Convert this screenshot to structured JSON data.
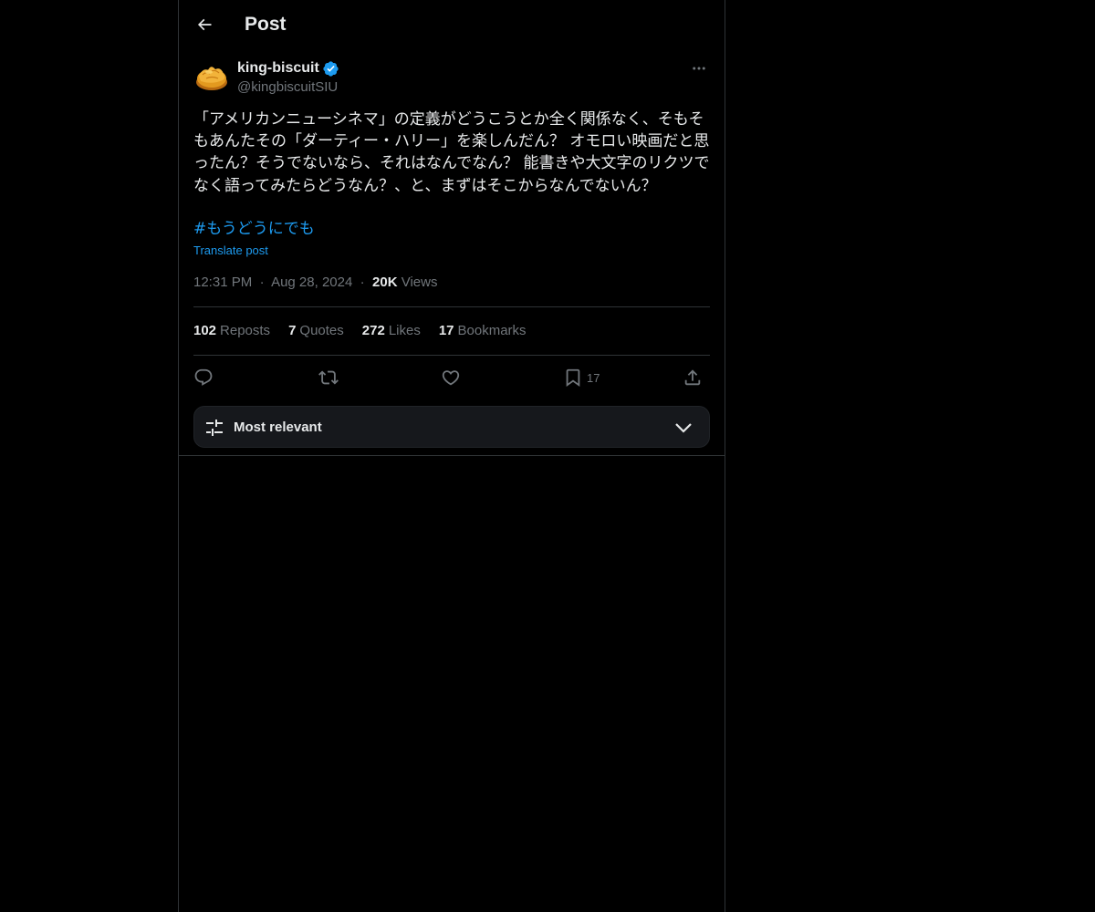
{
  "header": {
    "title": "Post",
    "back_icon": "arrow-left-icon"
  },
  "author": {
    "name": "king-biscuit",
    "handle": "@kingbiscuitSIU",
    "verified": true
  },
  "tweet": {
    "text": "「アメリカンニューシネマ」の定義がどうこうとか全く関係なく、そもそもあんたその「ダーティー・ハリー」を楽しんだん？ オモロい映画だと思ったん？そうでないなら、それはなんでなん？ 能書きや大文字のリクツでなく語ってみたらどうなん？、と、まずはそこからなんでないん？",
    "hashtag": "#もうどうにでも",
    "translate_label": "Translate post",
    "time": "12:31 PM",
    "date": "Aug 28, 2024",
    "separator": "·",
    "views_count": "20K",
    "views_label": "Views"
  },
  "stats": {
    "reposts": {
      "count": "102",
      "label": "Reposts"
    },
    "quotes": {
      "count": "7",
      "label": "Quotes"
    },
    "likes": {
      "count": "272",
      "label": "Likes"
    },
    "bookmarks": {
      "count": "17",
      "label": "Bookmarks"
    }
  },
  "actions": {
    "bookmark_count": "17"
  },
  "sort": {
    "label": "Most relevant"
  },
  "colors": {
    "background": "#000000",
    "text": "#e7e9ea",
    "secondary": "#71767b",
    "accent": "#1d9bf0",
    "border": "#2f3336"
  }
}
